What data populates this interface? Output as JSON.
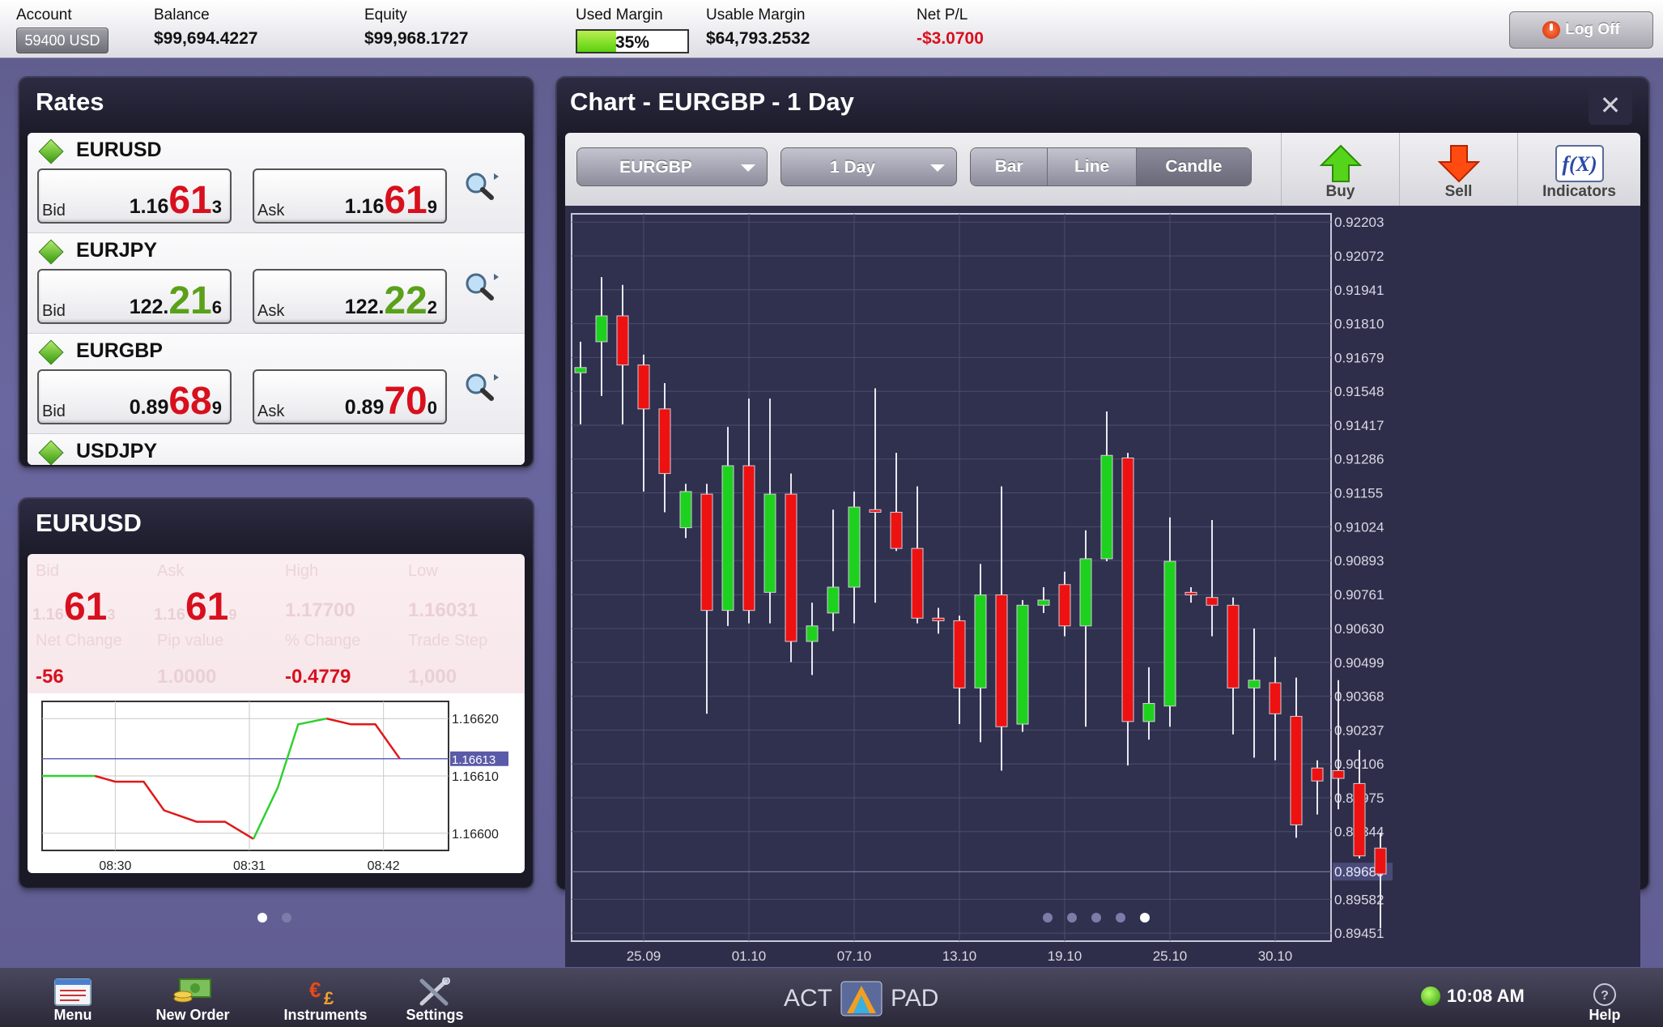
{
  "topbar": {
    "account_label": "Account",
    "account_value": "59400 USD",
    "balance_label": "Balance",
    "balance_value": "$99,694.4227",
    "equity_label": "Equity",
    "equity_value": "$99,968.1727",
    "used_margin_label": "Used Margin",
    "used_margin_value": "35%",
    "used_margin_fraction": 0.35,
    "usable_margin_label": "Usable Margin",
    "usable_margin_value": "$64,793.2532",
    "netpl_label": "Net P/L",
    "netpl_value": "-$3.0700",
    "logoff_label": "Log Off"
  },
  "rates": {
    "title": "Rates",
    "rows": [
      {
        "symbol": "EURUSD",
        "bid_label": "Bid",
        "bid_base": "1.16",
        "bid_big": "61",
        "bid_small": "3",
        "ask_label": "Ask",
        "ask_base": "1.16",
        "ask_big": "61",
        "ask_small": "9",
        "color": "red"
      },
      {
        "symbol": "EURJPY",
        "bid_label": "Bid",
        "bid_base": "122.",
        "bid_big": "21",
        "bid_small": "6",
        "ask_label": "Ask",
        "ask_base": "122.",
        "ask_big": "22",
        "ask_small": "2",
        "color": "green"
      },
      {
        "symbol": "EURGBP",
        "bid_label": "Bid",
        "bid_base": "0.89",
        "bid_big": "68",
        "bid_small": "9",
        "ask_label": "Ask",
        "ask_base": "0.89",
        "ask_big": "70",
        "ask_small": "0",
        "color": "red"
      },
      {
        "symbol": "USDJPY"
      }
    ]
  },
  "detail": {
    "title": "EURUSD",
    "labels": {
      "bid": "Bid",
      "ask": "Ask",
      "high": "High",
      "low": "Low",
      "net_change": "Net Change",
      "pip_value": "Pip value",
      "pct_change": "% Change",
      "trade_step": "Trade Step"
    },
    "bid_prefix": "1.16",
    "bid_big": "61",
    "bid_small": "3",
    "ask_prefix": "1.16",
    "ask_big": "61",
    "ask_small": "9",
    "high": "1.17700",
    "low": "1.16031",
    "net_change": "-56",
    "pip_value": "1.0000",
    "pct_change": "-0.4779",
    "trade_step": "1,000",
    "chart_data": {
      "type": "line",
      "x": [
        "08:30",
        "08:31",
        "08:42"
      ],
      "y_ticks": [
        "1.16620",
        "1.16610",
        "1.16600"
      ],
      "ylim": [
        1.16597,
        1.16623
      ],
      "current_price": "1.16613",
      "points": [
        [
          0,
          1.1661
        ],
        [
          0.13,
          1.1661
        ],
        [
          0.18,
          1.16609
        ],
        [
          0.25,
          1.16609
        ],
        [
          0.3,
          1.16604
        ],
        [
          0.38,
          1.16602
        ],
        [
          0.45,
          1.16602
        ],
        [
          0.52,
          1.16599
        ],
        [
          0.58,
          1.16608
        ],
        [
          0.63,
          1.16619
        ],
        [
          0.7,
          1.1662
        ],
        [
          0.76,
          1.16619
        ],
        [
          0.82,
          1.16619
        ],
        [
          0.88,
          1.16613
        ]
      ]
    }
  },
  "chart": {
    "title": "Chart - EURGBP - 1 Day",
    "symbol_dd": "EURGBP",
    "period_dd": "1 Day",
    "types": [
      "Bar",
      "Line",
      "Candle"
    ],
    "active_type": "Candle",
    "buy_label": "Buy",
    "sell_label": "Sell",
    "indicators_label": "Indicators",
    "chart_data": {
      "type": "candlestick",
      "x_ticks": [
        "25.09",
        "01.10",
        "07.10",
        "13.10",
        "19.10",
        "25.10",
        "30.10"
      ],
      "y_ticks": [
        "0.92203",
        "0.92072",
        "0.91941",
        "0.91810",
        "0.91679",
        "0.91548",
        "0.91417",
        "0.91286",
        "0.91155",
        "0.91024",
        "0.90893",
        "0.90761",
        "0.90630",
        "0.90499",
        "0.90368",
        "0.90237",
        "0.90106",
        "0.89975",
        "0.89844",
        "0.89582",
        "0.89451"
      ],
      "ylim": [
        0.8942,
        0.92235
      ],
      "current_price": "0.89689",
      "colors": {
        "up": "#1fd11f",
        "down": "#ee1111"
      },
      "candles": [
        [
          0.9162,
          0.9164,
          0.9174,
          0.9142
        ],
        [
          0.9174,
          0.9184,
          0.9199,
          0.9153
        ],
        [
          0.9184,
          0.9165,
          0.9196,
          0.9142
        ],
        [
          0.9165,
          0.9148,
          0.9169,
          0.9116
        ],
        [
          0.9148,
          0.9123,
          0.9158,
          0.9108
        ],
        [
          0.9102,
          0.9116,
          0.9119,
          0.9098
        ],
        [
          0.9115,
          0.907,
          0.9119,
          0.903
        ],
        [
          0.907,
          0.9126,
          0.9141,
          0.9064
        ],
        [
          0.9126,
          0.907,
          0.9152,
          0.9065
        ],
        [
          0.9077,
          0.9115,
          0.9152,
          0.9065
        ],
        [
          0.9115,
          0.9058,
          0.9123,
          0.905
        ],
        [
          0.9058,
          0.9064,
          0.9073,
          0.9045
        ],
        [
          0.9069,
          0.9079,
          0.9109,
          0.9062
        ],
        [
          0.9079,
          0.911,
          0.9116,
          0.9065
        ],
        [
          0.9109,
          0.9108,
          0.9156,
          0.9073
        ],
        [
          0.9108,
          0.9094,
          0.9131,
          0.9093
        ],
        [
          0.9094,
          0.9067,
          0.9118,
          0.9065
        ],
        [
          0.9067,
          0.9066,
          0.9071,
          0.9061
        ],
        [
          0.9066,
          0.904,
          0.9068,
          0.9026
        ],
        [
          0.904,
          0.9076,
          0.9088,
          0.9019
        ],
        [
          0.9076,
          0.9025,
          0.9118,
          0.9008
        ],
        [
          0.9026,
          0.9072,
          0.9074,
          0.9023
        ],
        [
          0.9072,
          0.9074,
          0.9079,
          0.9069
        ],
        [
          0.908,
          0.9064,
          0.9085,
          0.906
        ],
        [
          0.9064,
          0.909,
          0.9101,
          0.9025
        ],
        [
          0.909,
          0.913,
          0.9147,
          0.9089
        ],
        [
          0.9129,
          0.9027,
          0.9131,
          0.901
        ],
        [
          0.9027,
          0.9034,
          0.9048,
          0.902
        ],
        [
          0.9033,
          0.9089,
          0.9106,
          0.9025
        ],
        [
          0.9077,
          0.9076,
          0.9079,
          0.9073
        ],
        [
          0.9075,
          0.9072,
          0.9105,
          0.906
        ],
        [
          0.9072,
          0.904,
          0.9075,
          0.9022
        ],
        [
          0.904,
          0.9043,
          0.9063,
          0.9013
        ],
        [
          0.9042,
          0.903,
          0.9052,
          0.9012
        ],
        [
          0.9029,
          0.8987,
          0.9044,
          0.8982
        ],
        [
          0.9009,
          0.9004,
          0.9012,
          0.8991
        ],
        [
          0.9008,
          0.9005,
          0.9043,
          0.8993
        ],
        [
          0.9003,
          0.8975,
          0.9016,
          0.8974
        ],
        [
          0.8978,
          0.8968,
          0.8984,
          0.8947
        ]
      ]
    }
  },
  "bottombar": {
    "menu": "Menu",
    "new_order": "New Order",
    "instruments": "Instruments",
    "settings": "Settings",
    "logo_left": "ACT",
    "logo_right": "PAD",
    "time": "10:08 AM",
    "help": "Help"
  }
}
